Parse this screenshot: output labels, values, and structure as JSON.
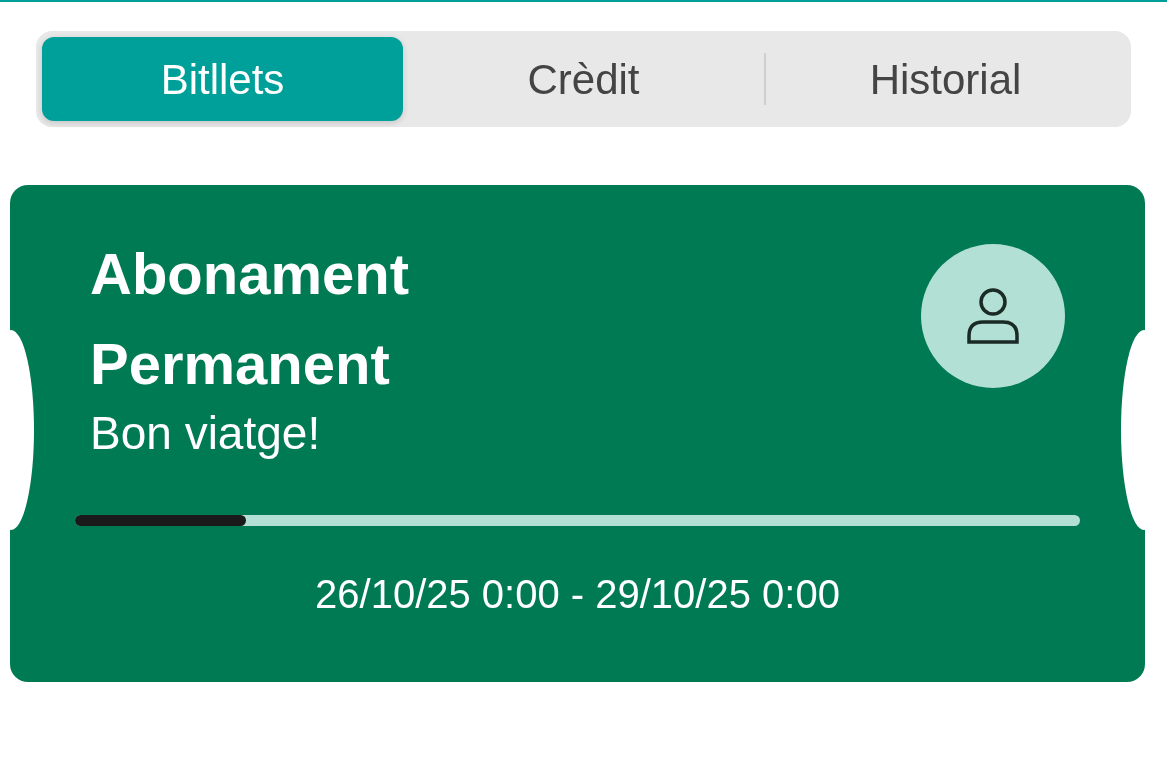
{
  "tabs": [
    {
      "label": "Bitllets",
      "selected": true
    },
    {
      "label": "Crèdit",
      "selected": false
    },
    {
      "label": "Historial",
      "selected": false
    }
  ],
  "ticket": {
    "title": "Abonament Permanent",
    "subtitle": "Bon viatge!",
    "level": 0.17,
    "validity": "26/10/25 0:00 - 29/10/25 0:00"
  }
}
